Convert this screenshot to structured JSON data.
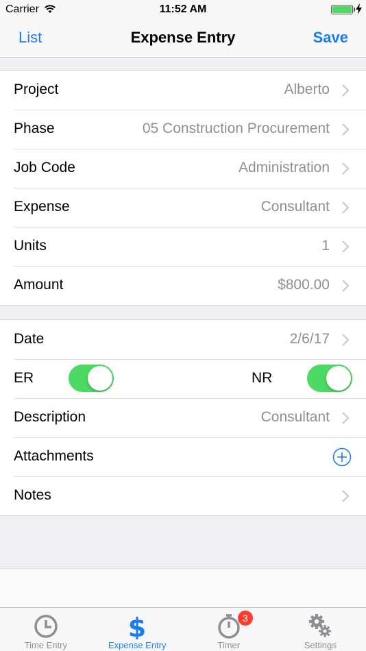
{
  "status_bar": {
    "carrier": "Carrier",
    "time": "11:52 AM",
    "battery_level": 1.0
  },
  "nav": {
    "back_label": "List",
    "title": "Expense Entry",
    "save_label": "Save"
  },
  "section1": {
    "rows": [
      {
        "label": "Project",
        "value": "Alberto"
      },
      {
        "label": "Phase",
        "value": "05 Construction Procurement"
      },
      {
        "label": "Job Code",
        "value": "Administration"
      },
      {
        "label": "Expense",
        "value": "Consultant"
      },
      {
        "label": "Units",
        "value": "1"
      },
      {
        "label": "Amount",
        "value": "$800.00"
      }
    ]
  },
  "section2": {
    "date": {
      "label": "Date",
      "value": "2/6/17"
    },
    "toggles": {
      "er": {
        "label": "ER",
        "on": true
      },
      "nr": {
        "label": "NR",
        "on": true
      }
    },
    "description": {
      "label": "Description",
      "value": "Consultant"
    },
    "attachments": {
      "label": "Attachments"
    },
    "notes": {
      "label": "Notes"
    }
  },
  "tabs": [
    {
      "label": "Time Entry",
      "icon": "clock-icon",
      "active": false
    },
    {
      "label": "Expense Entry",
      "icon": "dollar-icon",
      "active": true
    },
    {
      "label": "Timer",
      "icon": "stopwatch-icon",
      "active": false,
      "badge": "3"
    },
    {
      "label": "Settings",
      "icon": "gears-icon",
      "active": false
    }
  ],
  "colors": {
    "accent": "#1a7ef2",
    "toggle_on": "#4cd964",
    "badge": "#ff3b30",
    "secondary_text": "#8e8e93"
  }
}
